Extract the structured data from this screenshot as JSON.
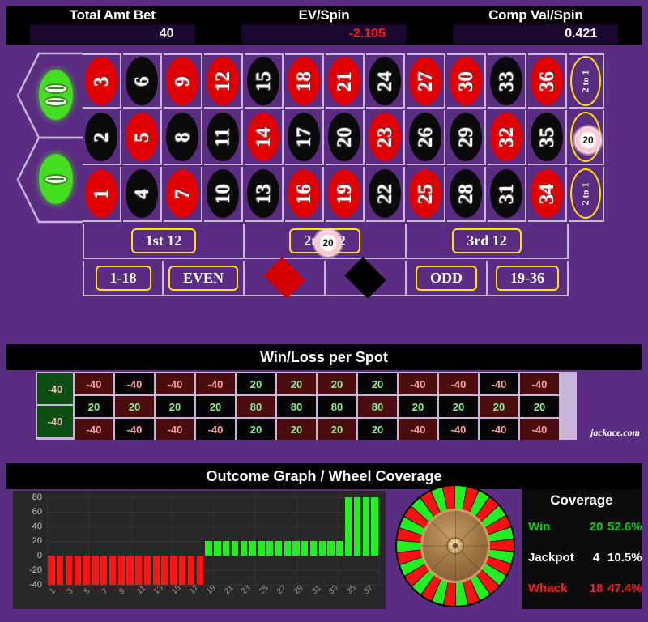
{
  "header": {
    "stats": [
      {
        "label": "Total Amt Bet",
        "value": "40",
        "negative": false
      },
      {
        "label": "EV/Spin",
        "value": "-2.105",
        "negative": true
      },
      {
        "label": "Comp Val/Spin",
        "value": "0.421",
        "negative": false
      }
    ]
  },
  "table": {
    "zeros": [
      {
        "label": "00",
        "name": "double-zero"
      },
      {
        "label": "0",
        "name": "zero"
      }
    ],
    "rows": [
      {
        "numbers": [
          {
            "n": "3",
            "color": "red"
          },
          {
            "n": "6",
            "color": "black"
          },
          {
            "n": "9",
            "color": "red"
          },
          {
            "n": "12",
            "color": "red"
          },
          {
            "n": "15",
            "color": "black"
          },
          {
            "n": "18",
            "color": "red"
          },
          {
            "n": "21",
            "color": "red"
          },
          {
            "n": "24",
            "color": "black"
          },
          {
            "n": "27",
            "color": "red"
          },
          {
            "n": "30",
            "color": "red"
          },
          {
            "n": "33",
            "color": "black"
          },
          {
            "n": "36",
            "color": "red"
          }
        ],
        "column_bet": "2 to 1",
        "chip": null
      },
      {
        "numbers": [
          {
            "n": "2",
            "color": "black"
          },
          {
            "n": "5",
            "color": "red"
          },
          {
            "n": "8",
            "color": "black"
          },
          {
            "n": "11",
            "color": "black"
          },
          {
            "n": "14",
            "color": "red"
          },
          {
            "n": "17",
            "color": "black"
          },
          {
            "n": "20",
            "color": "black"
          },
          {
            "n": "23",
            "color": "red"
          },
          {
            "n": "26",
            "color": "black"
          },
          {
            "n": "29",
            "color": "black"
          },
          {
            "n": "32",
            "color": "red"
          },
          {
            "n": "35",
            "color": "black"
          }
        ],
        "column_bet": "2 to 1",
        "chip": "20"
      },
      {
        "numbers": [
          {
            "n": "1",
            "color": "red"
          },
          {
            "n": "4",
            "color": "black"
          },
          {
            "n": "7",
            "color": "red"
          },
          {
            "n": "10",
            "color": "black"
          },
          {
            "n": "13",
            "color": "black"
          },
          {
            "n": "16",
            "color": "red"
          },
          {
            "n": "19",
            "color": "red"
          },
          {
            "n": "22",
            "color": "black"
          },
          {
            "n": "25",
            "color": "red"
          },
          {
            "n": "28",
            "color": "black"
          },
          {
            "n": "31",
            "color": "black"
          },
          {
            "n": "34",
            "color": "red"
          }
        ],
        "column_bet": "2 to 1",
        "chip": null
      }
    ],
    "dozens": [
      {
        "label": "1st 12",
        "chip": null
      },
      {
        "label": "2nd 12",
        "chip": "20"
      },
      {
        "label": "3rd 12",
        "chip": null
      }
    ],
    "outside": [
      {
        "label": "1-18",
        "kind": "pill"
      },
      {
        "label": "EVEN",
        "kind": "pill"
      },
      {
        "label": "",
        "kind": "diamond-red"
      },
      {
        "label": "",
        "kind": "diamond-black"
      },
      {
        "label": "ODD",
        "kind": "pill"
      },
      {
        "label": "19-36",
        "kind": "pill"
      }
    ]
  },
  "winloss": {
    "title": "Win/Loss per Spot",
    "zeros": [
      "-40",
      "-40"
    ],
    "rows": [
      {
        "cells": [
          {
            "v": "-40",
            "bg": "red"
          },
          {
            "v": "-40",
            "bg": "black"
          },
          {
            "v": "-40",
            "bg": "red"
          },
          {
            "v": "-40",
            "bg": "red"
          },
          {
            "v": "20",
            "bg": "black"
          },
          {
            "v": "20",
            "bg": "red"
          },
          {
            "v": "20",
            "bg": "red"
          },
          {
            "v": "20",
            "bg": "black"
          },
          {
            "v": "-40",
            "bg": "red"
          },
          {
            "v": "-40",
            "bg": "red"
          },
          {
            "v": "-40",
            "bg": "black"
          },
          {
            "v": "-40",
            "bg": "red"
          }
        ]
      },
      {
        "cells": [
          {
            "v": "20",
            "bg": "black"
          },
          {
            "v": "20",
            "bg": "red"
          },
          {
            "v": "20",
            "bg": "black"
          },
          {
            "v": "20",
            "bg": "black"
          },
          {
            "v": "80",
            "bg": "red"
          },
          {
            "v": "80",
            "bg": "black"
          },
          {
            "v": "80",
            "bg": "black"
          },
          {
            "v": "80",
            "bg": "red"
          },
          {
            "v": "20",
            "bg": "black"
          },
          {
            "v": "20",
            "bg": "black"
          },
          {
            "v": "20",
            "bg": "red"
          },
          {
            "v": "20",
            "bg": "black"
          }
        ]
      },
      {
        "cells": [
          {
            "v": "-40",
            "bg": "red"
          },
          {
            "v": "-40",
            "bg": "black"
          },
          {
            "v": "-40",
            "bg": "red"
          },
          {
            "v": "-40",
            "bg": "black"
          },
          {
            "v": "20",
            "bg": "black"
          },
          {
            "v": "20",
            "bg": "red"
          },
          {
            "v": "20",
            "bg": "red"
          },
          {
            "v": "20",
            "bg": "black"
          },
          {
            "v": "-40",
            "bg": "red"
          },
          {
            "v": "-40",
            "bg": "black"
          },
          {
            "v": "-40",
            "bg": "black"
          },
          {
            "v": "-40",
            "bg": "red"
          }
        ]
      }
    ],
    "brand": "jackace.com"
  },
  "outcome": {
    "title": "Outcome Graph / Wheel Coverage"
  },
  "chart_data": {
    "type": "bar",
    "title": "Outcome Graph / Wheel Coverage",
    "xlabel": "",
    "ylabel": "",
    "ylim": [
      -40,
      80
    ],
    "yticks": [
      80,
      60,
      40,
      20,
      0,
      -20,
      -40
    ],
    "grid": true,
    "x": [
      1,
      2,
      3,
      4,
      5,
      6,
      7,
      8,
      9,
      10,
      11,
      12,
      13,
      14,
      15,
      16,
      17,
      18,
      19,
      20,
      21,
      22,
      23,
      24,
      25,
      26,
      27,
      28,
      29,
      30,
      31,
      32,
      33,
      34,
      35,
      36,
      37,
      38
    ],
    "xtick_labels": [
      "1",
      "3",
      "5",
      "7",
      "9",
      "11",
      "13",
      "15",
      "17",
      "19",
      "21",
      "23",
      "25",
      "27",
      "29",
      "31",
      "33",
      "35",
      "37"
    ],
    "values": [
      -40,
      -40,
      -40,
      -40,
      -40,
      -40,
      -40,
      -40,
      -40,
      -40,
      -40,
      -40,
      -40,
      -40,
      -40,
      -40,
      -40,
      -40,
      20,
      20,
      20,
      20,
      20,
      20,
      20,
      20,
      20,
      20,
      20,
      20,
      20,
      20,
      20,
      20,
      80,
      80,
      80,
      80
    ],
    "colors": {
      "positive": "#22EE22",
      "negative": "#FF1414"
    }
  },
  "coverage": {
    "title": "Coverage",
    "rows": [
      {
        "name": "Win",
        "count": "20",
        "percent": "52.6%",
        "style": "win"
      },
      {
        "name": "Jackpot",
        "count": "4",
        "percent": "10.5%",
        "style": "jackpot"
      },
      {
        "name": "Whack",
        "count": "18",
        "percent": "47.4%",
        "style": "whack"
      }
    ]
  },
  "wheel": {
    "name": "roulette-wheel",
    "segments": 30,
    "colors": [
      "#22EE22",
      "#FF1010"
    ]
  }
}
